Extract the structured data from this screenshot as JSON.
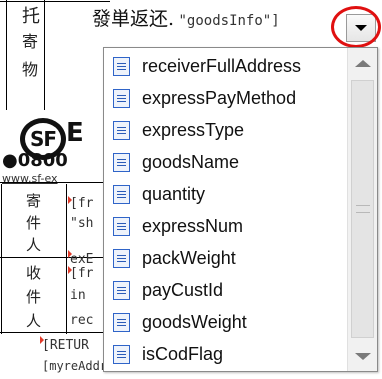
{
  "field": {
    "label": "發単返还.",
    "expression": "\"goodsInfo\"]"
  },
  "dropdown_items": [
    "receiverFullAddress",
    "expressPayMethod",
    "expressType",
    "goodsName",
    "quantity",
    "expressNum",
    "packWeight",
    "payCustId",
    "goodsWeight",
    "isCodFlag"
  ],
  "document": {
    "left_chars": [
      "托",
      "寄",
      "物"
    ],
    "logo_text": "SF",
    "logo_suffix": "E",
    "phone": "●0800",
    "site": "www.sf-ex",
    "sender_chars": [
      "寄",
      "件",
      "人"
    ],
    "receiver_chars": [
      "收",
      "件",
      "人"
    ],
    "code_lines": [
      "[fr",
      "\"sh",
      "exE",
      "[fr",
      "in",
      "rec"
    ],
    "bottom_code_1": "[RETUR",
    "bottom_code_2": "[myreAddressInfo]"
  },
  "colors": {
    "highlight": "#e01010",
    "icon_border": "#2f64c8",
    "marker": "#e23b2a"
  }
}
